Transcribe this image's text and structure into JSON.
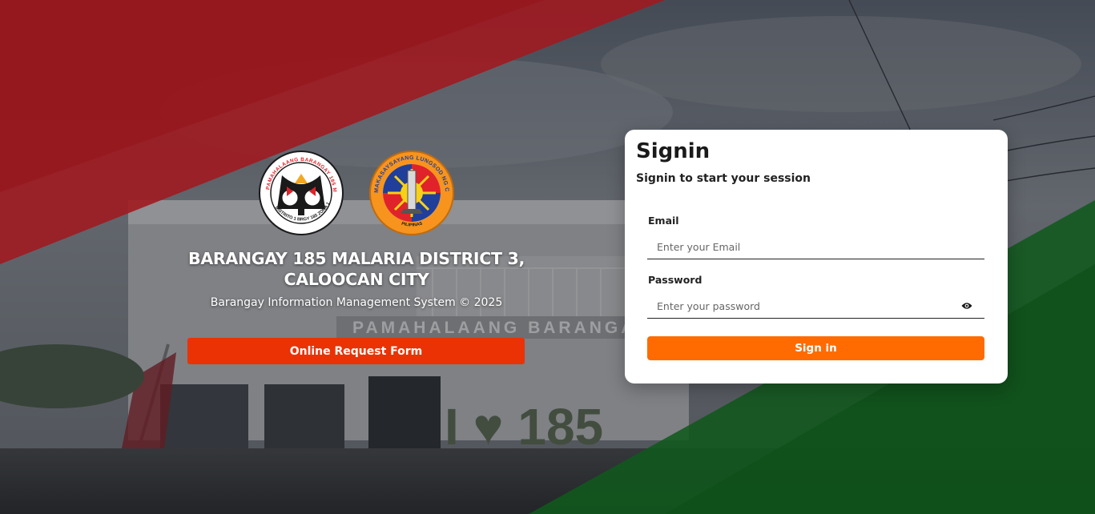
{
  "branding": {
    "title": "BARANGAY 185 MALARIA DISTRICT 3, CALOOCAN CITY",
    "subtitle": "Barangay Information Management System © 2025",
    "request_button_label": "Online Request Form",
    "logos": [
      {
        "icon": "barangay-seal-icon",
        "ring_text": "PAMAHALAANG BARANGAY 185 MALARIA",
        "bottom_text": "DISTRITO 1 BRGY 185 ZONA 16"
      },
      {
        "icon": "caloocan-city-seal-icon",
        "ring_text": "MAKASAYSAYANG LUNGSOD NG CALOOCAN",
        "bottom_text": "PILIPINAS"
      }
    ]
  },
  "background": {
    "sign_text": "PAMAHALAANG BARANGAY",
    "love_sign_text": "I ♥ 185"
  },
  "signin": {
    "title": "Signin",
    "subtitle": "Signin to start your session",
    "email_label": "Email",
    "email_placeholder": "Enter your Email",
    "email_value": "",
    "password_label": "Password",
    "password_placeholder": "Enter your password",
    "password_value": "",
    "password_toggle_icon": "eye-icon",
    "submit_label": "Sign in"
  },
  "colors": {
    "red_band": "#e8141b",
    "green_band": "#0c7a1c",
    "request_button": "#ea3205",
    "signin_button": "#ff6b00",
    "card_background": "#ffffff"
  }
}
